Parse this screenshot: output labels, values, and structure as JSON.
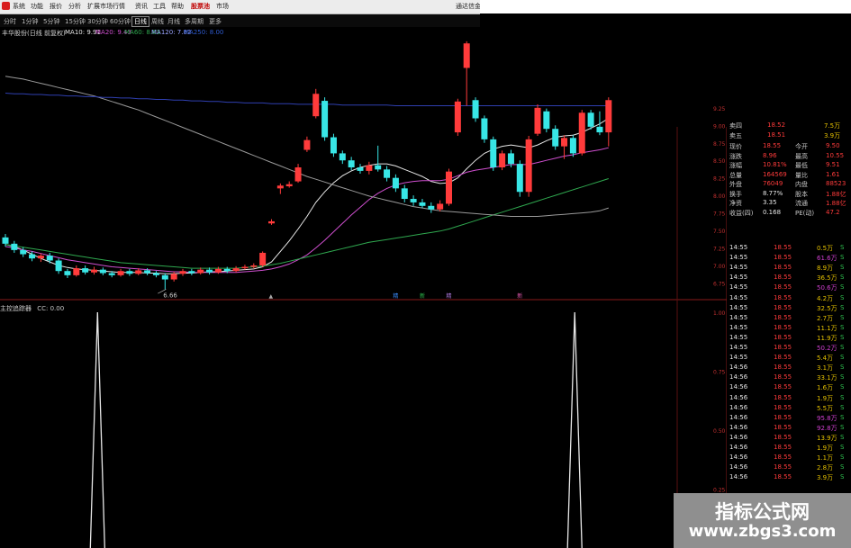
{
  "menu": {
    "items": [
      "系统",
      "功能",
      "报价",
      "分析",
      "扩展市场行情",
      "资讯",
      "工具",
      "帮助"
    ],
    "highlight": "股票池",
    "extra": "市场",
    "right_label": "通达信金"
  },
  "toolbar": {
    "periods": [
      "分时",
      "1分钟",
      "5分钟",
      "15分钟",
      "30分钟",
      "60分钟",
      "日线",
      "周线",
      "月线",
      "多周期",
      "更多"
    ],
    "active": "日线"
  },
  "ma_legend": {
    "stock": "丰华股份(日线 前复权)",
    "items": [
      {
        "label": "MA10: 9.91",
        "color": "#e6e6e6"
      },
      {
        "label": "MA20: 9.43",
        "color": "#cf4fcf"
      },
      {
        "label": "MA60: 8.63",
        "color": "#2fa84f"
      },
      {
        "label": "MA120: 7.82",
        "color": "#9aa4ff"
      },
      {
        "label": "MA250: 8.00",
        "color": "#2f5bd0"
      }
    ]
  },
  "price_axis": [
    "9.25",
    "9.00",
    "8.75",
    "8.50",
    "8.25",
    "8.00",
    "7.75",
    "7.50",
    "7.25",
    "7.00",
    "6.75"
  ],
  "low_label": "6.66",
  "indicator": {
    "name": "主控追踪器",
    "value": "CC: 0.00",
    "axis": [
      "1.00",
      "0.75",
      "0.50",
      "0.25"
    ]
  },
  "quote": {
    "rows": [
      {
        "label": "卖四",
        "price": "18.52",
        "vol": "7.5万"
      },
      {
        "label": "卖五",
        "price": "18.51",
        "vol": "3.9万"
      },
      {
        "label": "现价",
        "v1": "18.55",
        "label2": "今开",
        "v2": "9.50"
      },
      {
        "label": "涨跌",
        "v1": "8.96",
        "label2": "最高",
        "v2": "10.55"
      },
      {
        "label": "涨幅",
        "v1": "10.81%",
        "label2": "最低",
        "v2": "9.51"
      },
      {
        "label": "总量",
        "v1": "164569",
        "label2": "量比",
        "v2": "1.61"
      },
      {
        "label": "外盘",
        "v1": "76049",
        "label2": "内盘",
        "v2": "88523"
      },
      {
        "label": "换手",
        "v1": "8.77%",
        "label2": "股本",
        "v2": "1.88亿"
      },
      {
        "label": "净资",
        "v1": "3.35",
        "label2": "流通",
        "v2": "1.88亿"
      },
      {
        "label": "收益(四)",
        "v1": "0.168",
        "label2": "PE(动)",
        "v2": "47.2"
      }
    ]
  },
  "ticks": [
    {
      "t": "14:55",
      "p": "18.55",
      "v": "0.5万",
      "d": "S"
    },
    {
      "t": "14:55",
      "p": "18.55",
      "v": "61.6万",
      "d": "S"
    },
    {
      "t": "14:55",
      "p": "18.55",
      "v": "8.9万",
      "d": "S"
    },
    {
      "t": "14:55",
      "p": "18.55",
      "v": "36.5万",
      "d": "S"
    },
    {
      "t": "14:55",
      "p": "18.55",
      "v": "50.6万",
      "d": "S"
    },
    {
      "t": "14:55",
      "p": "18.55",
      "v": "4.2万",
      "d": "S"
    },
    {
      "t": "14:55",
      "p": "18.55",
      "v": "32.5万",
      "d": "S"
    },
    {
      "t": "14:55",
      "p": "18.55",
      "v": "2.7万",
      "d": "S"
    },
    {
      "t": "14:55",
      "p": "18.55",
      "v": "11.1万",
      "d": "S"
    },
    {
      "t": "14:55",
      "p": "18.55",
      "v": "11.9万",
      "d": "S"
    },
    {
      "t": "14:55",
      "p": "18.55",
      "v": "50.2万",
      "d": "S"
    },
    {
      "t": "14:55",
      "p": "18.55",
      "v": "5.4万",
      "d": "S"
    },
    {
      "t": "14:56",
      "p": "18.55",
      "v": "3.1万",
      "d": "S"
    },
    {
      "t": "14:56",
      "p": "18.55",
      "v": "33.1万",
      "d": "S"
    },
    {
      "t": "14:56",
      "p": "18.55",
      "v": "1.6万",
      "d": "S"
    },
    {
      "t": "14:56",
      "p": "18.55",
      "v": "1.9万",
      "d": "S"
    },
    {
      "t": "14:56",
      "p": "18.55",
      "v": "5.5万",
      "d": "S"
    },
    {
      "t": "14:56",
      "p": "18.55",
      "v": "95.8万",
      "d": "S"
    },
    {
      "t": "14:56",
      "p": "18.55",
      "v": "92.8万",
      "d": "S"
    },
    {
      "t": "14:56",
      "p": "18.55",
      "v": "13.9万",
      "d": "S"
    },
    {
      "t": "14:56",
      "p": "18.55",
      "v": "1.9万",
      "d": "S"
    },
    {
      "t": "14:56",
      "p": "18.55",
      "v": "1.1万",
      "d": "S"
    },
    {
      "t": "14:56",
      "p": "18.55",
      "v": "2.8万",
      "d": "S"
    },
    {
      "t": "14:56",
      "p": "18.55",
      "v": "3.9万",
      "d": "S"
    }
  ],
  "watermark": {
    "cn": "指标公式网",
    "url": "www.zbgs3.com"
  },
  "colors": {
    "up": "#ff3b3b",
    "down": "#38e6e6",
    "bg": "#000000",
    "border": "#8a1a1a"
  },
  "candles": [
    {
      "o": 7.4,
      "c": 7.31,
      "h": 7.45,
      "l": 7.27
    },
    {
      "o": 7.31,
      "c": 7.22,
      "h": 7.35,
      "l": 7.18
    },
    {
      "o": 7.22,
      "c": 7.16,
      "h": 7.26,
      "l": 7.12
    },
    {
      "o": 7.16,
      "c": 7.1,
      "h": 7.2,
      "l": 7.06
    },
    {
      "o": 7.1,
      "c": 7.14,
      "h": 7.17,
      "l": 7.05
    },
    {
      "o": 7.14,
      "c": 7.07,
      "h": 7.18,
      "l": 7.03
    },
    {
      "o": 7.07,
      "c": 6.92,
      "h": 7.1,
      "l": 6.88
    },
    {
      "o": 6.92,
      "c": 6.86,
      "h": 6.95,
      "l": 6.82
    },
    {
      "o": 6.86,
      "c": 6.96,
      "h": 7.0,
      "l": 6.84
    },
    {
      "o": 6.96,
      "c": 6.9,
      "h": 7.0,
      "l": 6.87
    },
    {
      "o": 6.9,
      "c": 6.94,
      "h": 6.98,
      "l": 6.87
    },
    {
      "o": 6.94,
      "c": 6.89,
      "h": 6.97,
      "l": 6.86
    },
    {
      "o": 6.89,
      "c": 6.86,
      "h": 6.92,
      "l": 6.83
    },
    {
      "o": 6.86,
      "c": 6.92,
      "h": 6.95,
      "l": 6.84
    },
    {
      "o": 6.92,
      "c": 6.88,
      "h": 6.95,
      "l": 6.85
    },
    {
      "o": 6.88,
      "c": 6.93,
      "h": 6.96,
      "l": 6.86
    },
    {
      "o": 6.93,
      "c": 6.89,
      "h": 6.96,
      "l": 6.86
    },
    {
      "o": 6.89,
      "c": 6.86,
      "h": 6.92,
      "l": 6.83
    },
    {
      "o": 6.86,
      "c": 6.8,
      "h": 6.89,
      "l": 6.66
    },
    {
      "o": 6.8,
      "c": 6.88,
      "h": 6.91,
      "l": 6.77
    },
    {
      "o": 6.88,
      "c": 6.92,
      "h": 6.95,
      "l": 6.85
    },
    {
      "o": 6.92,
      "c": 6.89,
      "h": 6.95,
      "l": 6.86
    },
    {
      "o": 6.89,
      "c": 6.94,
      "h": 6.97,
      "l": 6.87
    },
    {
      "o": 6.94,
      "c": 6.9,
      "h": 6.97,
      "l": 6.87
    },
    {
      "o": 6.9,
      "c": 6.95,
      "h": 6.98,
      "l": 6.88
    },
    {
      "o": 6.95,
      "c": 6.92,
      "h": 6.98,
      "l": 6.89
    },
    {
      "o": 6.92,
      "c": 6.96,
      "h": 6.99,
      "l": 6.9
    },
    {
      "o": 6.96,
      "c": 6.98,
      "h": 7.01,
      "l": 6.94
    },
    {
      "o": 6.98,
      "c": 7.0,
      "h": 7.03,
      "l": 6.96
    },
    {
      "o": 7.0,
      "c": 7.18,
      "h": 7.2,
      "l": 6.98
    },
    {
      "o": 7.6,
      "c": 7.63,
      "h": 7.66,
      "l": 7.58
    },
    {
      "o": 8.1,
      "c": 8.14,
      "h": 8.17,
      "l": 8.02
    },
    {
      "o": 8.13,
      "c": 8.16,
      "h": 8.2,
      "l": 8.11
    },
    {
      "o": 8.2,
      "c": 8.4,
      "h": 8.45,
      "l": 8.18
    },
    {
      "o": 8.65,
      "c": 8.79,
      "h": 8.84,
      "l": 8.62
    },
    {
      "o": 9.13,
      "c": 9.45,
      "h": 9.52,
      "l": 9.1
    },
    {
      "o": 9.35,
      "c": 8.83,
      "h": 9.4,
      "l": 8.78
    },
    {
      "o": 8.83,
      "c": 8.6,
      "h": 8.88,
      "l": 8.55
    },
    {
      "o": 8.6,
      "c": 8.5,
      "h": 8.64,
      "l": 8.45
    },
    {
      "o": 8.5,
      "c": 8.4,
      "h": 8.55,
      "l": 8.36
    },
    {
      "o": 8.4,
      "c": 8.35,
      "h": 8.45,
      "l": 8.31
    },
    {
      "o": 8.35,
      "c": 8.43,
      "h": 8.48,
      "l": 8.3
    },
    {
      "o": 8.43,
      "c": 8.37,
      "h": 8.71,
      "l": 8.34
    },
    {
      "o": 8.37,
      "c": 8.25,
      "h": 8.42,
      "l": 8.2
    },
    {
      "o": 8.25,
      "c": 8.1,
      "h": 8.3,
      "l": 8.05
    },
    {
      "o": 8.1,
      "c": 7.95,
      "h": 8.15,
      "l": 7.9
    },
    {
      "o": 7.95,
      "c": 7.9,
      "h": 8.0,
      "l": 7.85
    },
    {
      "o": 7.9,
      "c": 7.85,
      "h": 7.95,
      "l": 7.82
    },
    {
      "o": 7.85,
      "c": 7.8,
      "h": 7.9,
      "l": 7.75
    },
    {
      "o": 7.8,
      "c": 7.88,
      "h": 7.93,
      "l": 7.77
    },
    {
      "o": 7.88,
      "c": 8.34,
      "h": 8.38,
      "l": 7.85
    },
    {
      "o": 8.9,
      "c": 9.34,
      "h": 9.38,
      "l": 8.85
    },
    {
      "o": 9.82,
      "c": 10.17,
      "h": 10.2,
      "l": 9.28
    },
    {
      "o": 9.36,
      "c": 9.1,
      "h": 9.4,
      "l": 9.05
    },
    {
      "o": 9.1,
      "c": 8.8,
      "h": 9.14,
      "l": 8.75
    },
    {
      "o": 8.8,
      "c": 8.4,
      "h": 8.84,
      "l": 8.35
    },
    {
      "o": 8.4,
      "c": 8.6,
      "h": 8.64,
      "l": 8.36
    },
    {
      "o": 8.6,
      "c": 8.45,
      "h": 8.65,
      "l": 8.4
    },
    {
      "o": 8.45,
      "c": 8.05,
      "h": 8.5,
      "l": 7.98
    },
    {
      "o": 8.05,
      "c": 8.8,
      "h": 8.85,
      "l": 7.98
    },
    {
      "o": 8.88,
      "c": 9.25,
      "h": 9.3,
      "l": 8.85
    },
    {
      "o": 9.2,
      "c": 8.95,
      "h": 9.24,
      "l": 8.9
    },
    {
      "o": 8.95,
      "c": 8.7,
      "h": 9.0,
      "l": 8.65
    },
    {
      "o": 8.7,
      "c": 8.82,
      "h": 8.86,
      "l": 8.52
    },
    {
      "o": 8.82,
      "c": 8.6,
      "h": 8.86,
      "l": 8.55
    },
    {
      "o": 8.6,
      "c": 9.18,
      "h": 9.22,
      "l": 8.57
    },
    {
      "o": 9.18,
      "c": 8.98,
      "h": 9.22,
      "l": 8.94
    },
    {
      "o": 8.98,
      "c": 8.9,
      "h": 9.2,
      "l": 8.86
    },
    {
      "o": 8.9,
      "c": 9.36,
      "h": 9.4,
      "l": 8.7
    }
  ],
  "ma_lines": {
    "ma10": [
      7.3,
      7.27,
      7.22,
      7.16,
      7.1,
      7.05,
      7.0,
      6.97,
      6.95,
      6.94,
      6.93,
      6.92,
      6.91,
      6.9,
      6.9,
      6.9,
      6.89,
      6.89,
      6.88,
      6.88,
      6.89,
      6.89,
      6.9,
      6.91,
      6.91,
      6.92,
      6.93,
      6.94,
      6.95,
      6.98,
      7.05,
      7.2,
      7.35,
      7.52,
      7.7,
      7.9,
      8.05,
      8.18,
      8.28,
      8.35,
      8.4,
      8.43,
      8.45,
      8.45,
      8.42,
      8.37,
      8.32,
      8.27,
      8.2,
      8.17,
      8.18,
      8.25,
      8.38,
      8.5,
      8.6,
      8.66,
      8.7,
      8.72,
      8.7,
      8.68,
      8.72,
      8.78,
      8.83,
      8.85,
      8.86,
      8.9,
      8.96,
      9.02,
      9.1
    ],
    "ma20": [
      7.27,
      7.25,
      7.22,
      7.2,
      7.17,
      7.14,
      7.11,
      7.08,
      7.06,
      7.04,
      7.02,
      7.0,
      6.98,
      6.97,
      6.96,
      6.95,
      6.94,
      6.93,
      6.92,
      6.91,
      6.91,
      6.9,
      6.9,
      6.9,
      6.9,
      6.9,
      6.9,
      6.91,
      6.92,
      6.93,
      6.95,
      6.98,
      7.02,
      7.08,
      7.15,
      7.25,
      7.36,
      7.48,
      7.6,
      7.72,
      7.83,
      7.94,
      8.03,
      8.1,
      8.15,
      8.18,
      8.2,
      8.21,
      8.21,
      8.21,
      8.23,
      8.28,
      8.33,
      8.36,
      8.38,
      8.4,
      8.42,
      8.44,
      8.44,
      8.44,
      8.47,
      8.5,
      8.53,
      8.56,
      8.58,
      8.61,
      8.63,
      8.65,
      8.68
    ],
    "ma60": [
      7.3,
      7.28,
      7.26,
      7.24,
      7.22,
      7.2,
      7.18,
      7.16,
      7.14,
      7.12,
      7.1,
      7.08,
      7.06,
      7.04,
      7.03,
      7.02,
      7.01,
      7.0,
      6.99,
      6.98,
      6.97,
      6.96,
      6.96,
      6.96,
      6.96,
      6.96,
      6.96,
      6.97,
      6.98,
      6.99,
      7.01,
      7.03,
      7.06,
      7.09,
      7.12,
      7.15,
      7.18,
      7.21,
      7.24,
      7.27,
      7.3,
      7.33,
      7.35,
      7.37,
      7.39,
      7.41,
      7.43,
      7.45,
      7.47,
      7.49,
      7.52,
      7.56,
      7.6,
      7.64,
      7.68,
      7.72,
      7.76,
      7.8,
      7.84,
      7.88,
      7.92,
      7.96,
      8.0,
      8.04,
      8.08,
      8.12,
      8.16,
      8.2,
      8.24
    ],
    "ma120": [
      9.7,
      9.68,
      9.66,
      9.63,
      9.6,
      9.57,
      9.54,
      9.51,
      9.48,
      9.45,
      9.42,
      9.38,
      9.34,
      9.3,
      9.26,
      9.22,
      9.17,
      9.12,
      9.07,
      9.02,
      8.97,
      8.92,
      8.87,
      8.82,
      8.77,
      8.72,
      8.67,
      8.62,
      8.57,
      8.52,
      8.47,
      8.42,
      8.37,
      8.32,
      8.27,
      8.23,
      8.19,
      8.15,
      8.11,
      8.07,
      8.03,
      7.99,
      7.96,
      7.93,
      7.9,
      7.87,
      7.84,
      7.82,
      7.8,
      7.78,
      7.77,
      7.76,
      7.75,
      7.74,
      7.73,
      7.72,
      7.71,
      7.7,
      7.7,
      7.7,
      7.7,
      7.71,
      7.72,
      7.73,
      7.74,
      7.75,
      7.76,
      7.78,
      7.82
    ],
    "ma250": [
      9.46,
      9.45,
      9.45,
      9.44,
      9.44,
      9.43,
      9.43,
      9.42,
      9.42,
      9.41,
      9.41,
      9.4,
      9.4,
      9.39,
      9.39,
      9.38,
      9.38,
      9.37,
      9.37,
      9.36,
      9.36,
      9.35,
      9.35,
      9.34,
      9.34,
      9.33,
      9.33,
      9.32,
      9.32,
      9.32,
      9.31,
      9.31,
      9.31,
      9.3,
      9.3,
      9.3,
      9.3,
      9.3,
      9.29,
      9.29,
      9.29,
      9.29,
      9.29,
      9.29,
      9.28,
      9.28,
      9.28,
      9.28,
      9.28,
      9.28,
      9.28,
      9.28,
      9.28,
      9.28,
      9.28,
      9.28,
      9.28,
      9.28,
      9.28,
      9.28,
      9.28,
      9.28,
      9.28,
      9.28,
      9.28,
      9.28,
      9.28,
      9.28,
      9.28
    ]
  },
  "indicator_spikes": [
    {
      "index": 18,
      "value": 1.0
    },
    {
      "index": 52,
      "value": 1.0
    }
  ],
  "markers": [
    {
      "index": 30,
      "label": "▲"
    },
    {
      "index": 44,
      "label": "精"
    },
    {
      "index": 47,
      "label": "新"
    },
    {
      "index": 50,
      "label": "精"
    },
    {
      "index": 58,
      "label": "新"
    }
  ]
}
